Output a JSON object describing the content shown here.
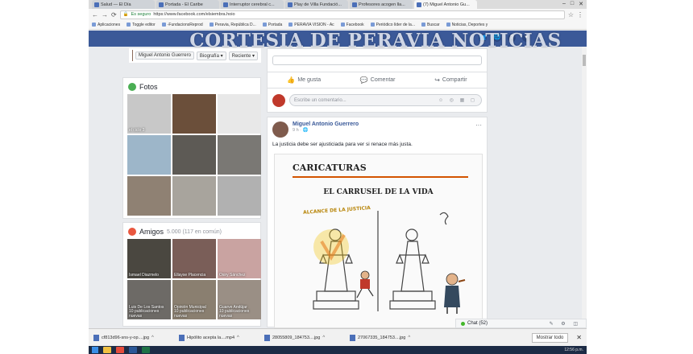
{
  "watermark": "CORTESIA DE PERAVIA NOTICIAS",
  "browser": {
    "tabs": [
      {
        "label": "Salud — El Día"
      },
      {
        "label": "Portada - El Caribe"
      },
      {
        "label": "Interruptor cerebral c..."
      },
      {
        "label": "Play de Villa Fundació..."
      },
      {
        "label": "Profesores acogen lla..."
      },
      {
        "label": "(7) Miguel Antonio Gu..."
      }
    ],
    "address": {
      "secure_label": "Es seguro",
      "url": "https://www.facebook.com/elsiembra.hoio"
    },
    "bookmarks": [
      "Aplicaciones",
      "Toggle editor",
      "-FundacionsReprod",
      "Peravia, República D...",
      "Portada",
      "PERAVIA VISION - Ac",
      "Facebook",
      "Periódico líder de la...",
      "Buscar",
      "Noticias, Deportes y"
    ]
  },
  "profile": {
    "name": "Miguel Antonio Guerrero",
    "menus": [
      "Biografía",
      "Reciente"
    ]
  },
  "fotos": {
    "title": "Fotos",
    "photos": [
      {
        "caption": "el ciclo 3",
        "color": "#c8c8c8"
      },
      {
        "caption": "",
        "color": "#6b4f3a"
      },
      {
        "caption": "",
        "color": "#e8e8e8"
      },
      {
        "caption": "",
        "color": "#9db6c9"
      },
      {
        "caption": "",
        "color": "#5d5a55"
      },
      {
        "caption": "",
        "color": "#7a7874"
      },
      {
        "caption": "",
        "color": "#8f8173"
      },
      {
        "caption": "",
        "color": "#a8a49d"
      },
      {
        "caption": "",
        "color": "#b1b1b1"
      }
    ]
  },
  "amigos": {
    "title": "Amigos",
    "count_text": "5.000 (117 en común)",
    "friends": [
      {
        "name": "Ismael Diazmelo",
        "color": "#4a4740"
      },
      {
        "name": "Ellayse Placencia",
        "color": "#7a5e58"
      },
      {
        "name": "Osiry Sánchez",
        "color": "#c9a3a1"
      },
      {
        "name": "Luis De Los Santos",
        "sub": "10 publicaciones nuevas",
        "color": "#6d6a66"
      },
      {
        "name": "Opinión Municipal",
        "sub": "10 publicaciones nuevas",
        "color": "#8a7f70"
      },
      {
        "name": "Guarve Andújar",
        "sub": "10 publicaciones nuevas",
        "color": "#9a8f85"
      }
    ]
  },
  "post_actions": {
    "like": "Me gusta",
    "comment": "Comentar",
    "share": "Compartir"
  },
  "comment_box": {
    "placeholder": "Escribe un comentario..."
  },
  "post": {
    "author": "Miguel Antonio Guerrero",
    "time": "9 h",
    "text": "La justicia debe ser ajusticiada para ver si renace más justa.",
    "image": {
      "heading": "CARICATURAS",
      "subtitle": "EL CARRUSEL DE LA VIDA",
      "banner": "ALCANCE DE LA JUSTICIA"
    }
  },
  "chat": {
    "label": "Chat (52)"
  },
  "downloads": [
    {
      "name": "cf813d96-sns-y-op....jpg"
    },
    {
      "name": "Hipólito acepta la....mp4"
    },
    {
      "name": "28055809_184753....jpg"
    },
    {
      "name": "27067335_184753....jpg"
    }
  ],
  "download_bar": {
    "show_all": "Mostrar todo"
  },
  "taskbar": {
    "time": "12:56 p.m."
  },
  "colors": {
    "facebook_blue": "#3b5998",
    "link": "#385898"
  }
}
